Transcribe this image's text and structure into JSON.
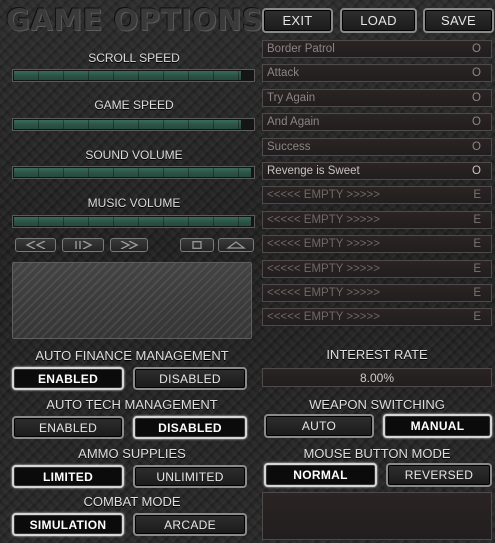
{
  "title": "GAME OPTIONS",
  "top_buttons": {
    "exit": "EXIT",
    "load": "LOAD",
    "save": "SAVE"
  },
  "sliders": {
    "scroll_speed": {
      "label": "SCROLL SPEED",
      "level": 0.95
    },
    "game_speed": {
      "label": "GAME SPEED",
      "level": 0.95
    },
    "sound_volume": {
      "label": "SOUND VOLUME",
      "level": 0.99
    },
    "music_volume": {
      "label": "MUSIC VOLUME",
      "level": 0.99
    }
  },
  "media_controls": [
    {
      "name": "rewind-icon"
    },
    {
      "name": "play-icon"
    },
    {
      "name": "fast-forward-icon"
    },
    {
      "name": "stop-icon"
    },
    {
      "name": "eject-icon"
    }
  ],
  "save_slots": [
    {
      "name": "Border Patrol",
      "status": "O",
      "active": false,
      "empty": false
    },
    {
      "name": "Attack",
      "status": "O",
      "active": false,
      "empty": false
    },
    {
      "name": "Try Again",
      "status": "O",
      "active": false,
      "empty": false
    },
    {
      "name": "And Again",
      "status": "O",
      "active": false,
      "empty": false
    },
    {
      "name": "Success",
      "status": "O",
      "active": false,
      "empty": false
    },
    {
      "name": "Revenge is Sweet",
      "status": "O",
      "active": true,
      "empty": false
    },
    {
      "name": "<<<<< EMPTY >>>>>",
      "status": "E",
      "active": false,
      "empty": true
    },
    {
      "name": "<<<<< EMPTY >>>>>",
      "status": "E",
      "active": false,
      "empty": true
    },
    {
      "name": "<<<<< EMPTY >>>>>",
      "status": "E",
      "active": false,
      "empty": true
    },
    {
      "name": "<<<<< EMPTY >>>>>",
      "status": "E",
      "active": false,
      "empty": true
    },
    {
      "name": "<<<<< EMPTY >>>>>",
      "status": "E",
      "active": false,
      "empty": true
    },
    {
      "name": "<<<<< EMPTY >>>>>",
      "status": "E",
      "active": false,
      "empty": true
    }
  ],
  "auto_finance": {
    "label": "AUTO FINANCE MANAGEMENT",
    "enabled": "ENABLED",
    "disabled": "DISABLED",
    "selected": "enabled"
  },
  "auto_tech": {
    "label": "AUTO TECH MANAGEMENT",
    "enabled": "ENABLED",
    "disabled": "DISABLED",
    "selected": "disabled"
  },
  "ammo_supplies": {
    "label": "AMMO SUPPLIES",
    "limited": "LIMITED",
    "unlimited": "UNLIMITED",
    "selected": "limited"
  },
  "combat_mode": {
    "label": "COMBAT MODE",
    "simulation": "SIMULATION",
    "arcade": "ARCADE",
    "selected": "simulation"
  },
  "interest_rate": {
    "label": "INTEREST RATE",
    "value": "8.00%"
  },
  "weapon_switching": {
    "label": "WEAPON SWITCHING",
    "auto": "AUTO",
    "manual": "MANUAL",
    "selected": "manual"
  },
  "mouse_button_mode": {
    "label": "MOUSE BUTTON MODE",
    "normal": "NORMAL",
    "reversed": "REVERSED",
    "selected": "normal"
  },
  "colors": {
    "slider_fill": "#2a5346",
    "slot_bg": "#241f20",
    "selected_border": "#d6d6d6"
  }
}
